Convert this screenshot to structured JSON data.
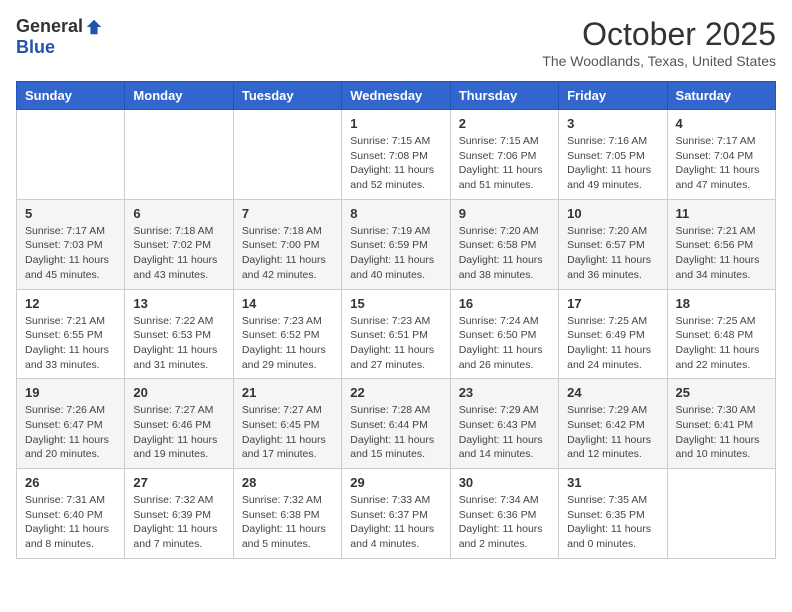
{
  "header": {
    "logo_general": "General",
    "logo_blue": "Blue",
    "month": "October 2025",
    "location": "The Woodlands, Texas, United States"
  },
  "weekdays": [
    "Sunday",
    "Monday",
    "Tuesday",
    "Wednesday",
    "Thursday",
    "Friday",
    "Saturday"
  ],
  "weeks": [
    [
      {
        "day": "",
        "info": ""
      },
      {
        "day": "",
        "info": ""
      },
      {
        "day": "",
        "info": ""
      },
      {
        "day": "1",
        "info": "Sunrise: 7:15 AM\nSunset: 7:08 PM\nDaylight: 11 hours\nand 52 minutes."
      },
      {
        "day": "2",
        "info": "Sunrise: 7:15 AM\nSunset: 7:06 PM\nDaylight: 11 hours\nand 51 minutes."
      },
      {
        "day": "3",
        "info": "Sunrise: 7:16 AM\nSunset: 7:05 PM\nDaylight: 11 hours\nand 49 minutes."
      },
      {
        "day": "4",
        "info": "Sunrise: 7:17 AM\nSunset: 7:04 PM\nDaylight: 11 hours\nand 47 minutes."
      }
    ],
    [
      {
        "day": "5",
        "info": "Sunrise: 7:17 AM\nSunset: 7:03 PM\nDaylight: 11 hours\nand 45 minutes."
      },
      {
        "day": "6",
        "info": "Sunrise: 7:18 AM\nSunset: 7:02 PM\nDaylight: 11 hours\nand 43 minutes."
      },
      {
        "day": "7",
        "info": "Sunrise: 7:18 AM\nSunset: 7:00 PM\nDaylight: 11 hours\nand 42 minutes."
      },
      {
        "day": "8",
        "info": "Sunrise: 7:19 AM\nSunset: 6:59 PM\nDaylight: 11 hours\nand 40 minutes."
      },
      {
        "day": "9",
        "info": "Sunrise: 7:20 AM\nSunset: 6:58 PM\nDaylight: 11 hours\nand 38 minutes."
      },
      {
        "day": "10",
        "info": "Sunrise: 7:20 AM\nSunset: 6:57 PM\nDaylight: 11 hours\nand 36 minutes."
      },
      {
        "day": "11",
        "info": "Sunrise: 7:21 AM\nSunset: 6:56 PM\nDaylight: 11 hours\nand 34 minutes."
      }
    ],
    [
      {
        "day": "12",
        "info": "Sunrise: 7:21 AM\nSunset: 6:55 PM\nDaylight: 11 hours\nand 33 minutes."
      },
      {
        "day": "13",
        "info": "Sunrise: 7:22 AM\nSunset: 6:53 PM\nDaylight: 11 hours\nand 31 minutes."
      },
      {
        "day": "14",
        "info": "Sunrise: 7:23 AM\nSunset: 6:52 PM\nDaylight: 11 hours\nand 29 minutes."
      },
      {
        "day": "15",
        "info": "Sunrise: 7:23 AM\nSunset: 6:51 PM\nDaylight: 11 hours\nand 27 minutes."
      },
      {
        "day": "16",
        "info": "Sunrise: 7:24 AM\nSunset: 6:50 PM\nDaylight: 11 hours\nand 26 minutes."
      },
      {
        "day": "17",
        "info": "Sunrise: 7:25 AM\nSunset: 6:49 PM\nDaylight: 11 hours\nand 24 minutes."
      },
      {
        "day": "18",
        "info": "Sunrise: 7:25 AM\nSunset: 6:48 PM\nDaylight: 11 hours\nand 22 minutes."
      }
    ],
    [
      {
        "day": "19",
        "info": "Sunrise: 7:26 AM\nSunset: 6:47 PM\nDaylight: 11 hours\nand 20 minutes."
      },
      {
        "day": "20",
        "info": "Sunrise: 7:27 AM\nSunset: 6:46 PM\nDaylight: 11 hours\nand 19 minutes."
      },
      {
        "day": "21",
        "info": "Sunrise: 7:27 AM\nSunset: 6:45 PM\nDaylight: 11 hours\nand 17 minutes."
      },
      {
        "day": "22",
        "info": "Sunrise: 7:28 AM\nSunset: 6:44 PM\nDaylight: 11 hours\nand 15 minutes."
      },
      {
        "day": "23",
        "info": "Sunrise: 7:29 AM\nSunset: 6:43 PM\nDaylight: 11 hours\nand 14 minutes."
      },
      {
        "day": "24",
        "info": "Sunrise: 7:29 AM\nSunset: 6:42 PM\nDaylight: 11 hours\nand 12 minutes."
      },
      {
        "day": "25",
        "info": "Sunrise: 7:30 AM\nSunset: 6:41 PM\nDaylight: 11 hours\nand 10 minutes."
      }
    ],
    [
      {
        "day": "26",
        "info": "Sunrise: 7:31 AM\nSunset: 6:40 PM\nDaylight: 11 hours\nand 8 minutes."
      },
      {
        "day": "27",
        "info": "Sunrise: 7:32 AM\nSunset: 6:39 PM\nDaylight: 11 hours\nand 7 minutes."
      },
      {
        "day": "28",
        "info": "Sunrise: 7:32 AM\nSunset: 6:38 PM\nDaylight: 11 hours\nand 5 minutes."
      },
      {
        "day": "29",
        "info": "Sunrise: 7:33 AM\nSunset: 6:37 PM\nDaylight: 11 hours\nand 4 minutes."
      },
      {
        "day": "30",
        "info": "Sunrise: 7:34 AM\nSunset: 6:36 PM\nDaylight: 11 hours\nand 2 minutes."
      },
      {
        "day": "31",
        "info": "Sunrise: 7:35 AM\nSunset: 6:35 PM\nDaylight: 11 hours\nand 0 minutes."
      },
      {
        "day": "",
        "info": ""
      }
    ]
  ]
}
